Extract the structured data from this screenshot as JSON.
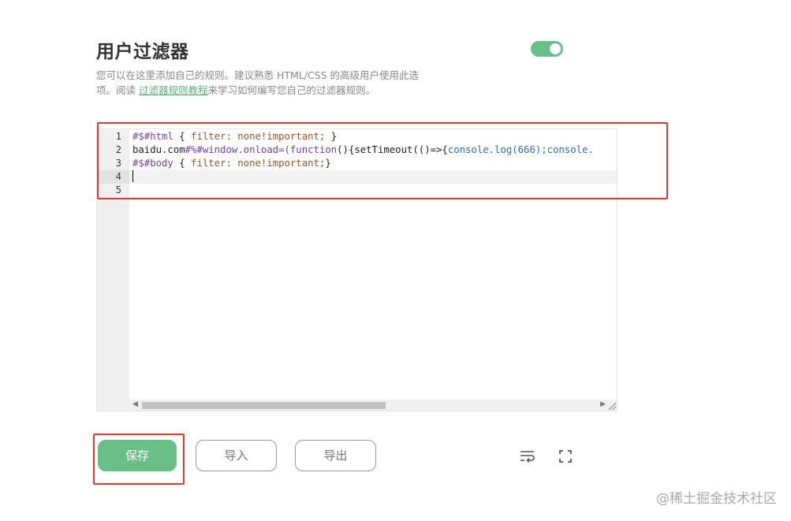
{
  "header": {
    "title": "用户过滤器",
    "toggle_on": true
  },
  "description": {
    "line1": "您可以在这里添加自己的规则。建议熟悉 HTML/CSS 的高级用户使用此选",
    "line2_prefix": "项。阅读 ",
    "link_text": "过滤器规则教程",
    "line2_suffix": "来学习如何编写您自己的过滤器规则。"
  },
  "editor": {
    "line_numbers": [
      "1",
      "2",
      "3",
      "4",
      "5"
    ],
    "lines": [
      {
        "p1": "#$#html",
        "p2": " { ",
        "p3": "filter: none!important;",
        "p4": " }"
      },
      {
        "p1": "baidu.com",
        "p2": "#%#window.onload=(function",
        "p3": "(){setTimeout(()=>{",
        "p4": "console.log(666);console."
      },
      {
        "p1": "#$#body",
        "p2": " { ",
        "p3": "filter: none!important;",
        "p4": "}"
      }
    ]
  },
  "buttons": {
    "save": "保存",
    "import": "导入",
    "export": "导出"
  },
  "icons": {
    "wrap": "wrap-lines-icon",
    "fullscreen": "fullscreen-icon"
  },
  "watermark": "@稀土掘金技术社区",
  "colors": {
    "accent": "#6abf87",
    "annotation": "#e03a2f"
  }
}
